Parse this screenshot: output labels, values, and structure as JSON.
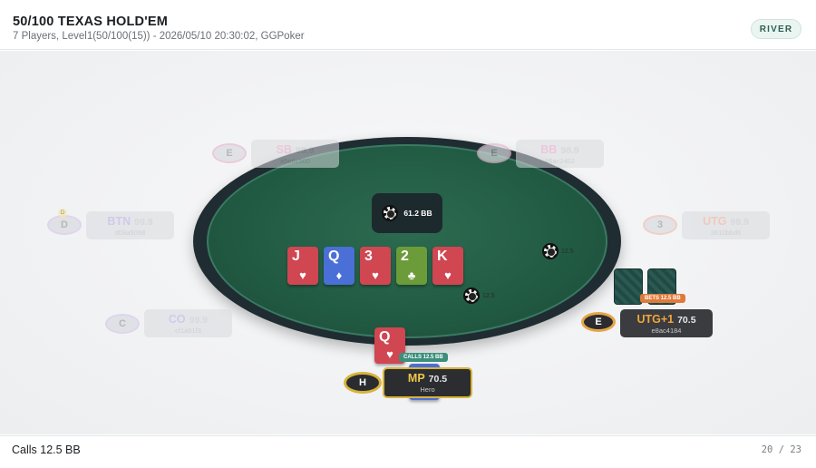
{
  "header": {
    "title": "50/100 TEXAS HOLD'EM",
    "subtitle": "7 Players, Level1(50/100(15)) - 2026/05/10 20:30:02, GGPoker",
    "street": "RIVER"
  },
  "pot": {
    "label": "61.2 BB"
  },
  "board": [
    {
      "rank": "J",
      "suit": "♥",
      "color": "red"
    },
    {
      "rank": "Q",
      "suit": "♦",
      "color": "blue"
    },
    {
      "rank": "3",
      "suit": "♥",
      "color": "red"
    },
    {
      "rank": "2",
      "suit": "♣",
      "color": "green"
    },
    {
      "rank": "K",
      "suit": "♥",
      "color": "red"
    }
  ],
  "bets": {
    "right": "12.5",
    "center": "12.5"
  },
  "seats": {
    "sb": {
      "avatar": "E",
      "position": "SB",
      "stack": "99.9",
      "id": "a5e6c500"
    },
    "bb": {
      "avatar": "E",
      "position": "BB",
      "stack": "98.9",
      "id": "86ac2402"
    },
    "btn": {
      "avatar": "D",
      "dealer": "D",
      "position": "BTN",
      "stack": "99.9",
      "id": "d09a5068"
    },
    "utg": {
      "avatar": "3",
      "position": "UTG",
      "stack": "99.9",
      "id": "3610bbd6"
    },
    "co": {
      "avatar": "C",
      "position": "CO",
      "stack": "99.9",
      "id": "cf1a61f3"
    },
    "utg1": {
      "avatar": "E",
      "position": "UTG+1",
      "stack": "70.5",
      "id": "e8ac4184",
      "action": "BETS 12.5 BB"
    },
    "mp": {
      "avatar": "H",
      "position": "MP",
      "stack": "70.5",
      "id": "Hero",
      "action": "CALLS 12.5 BB",
      "cards": [
        {
          "rank": "Q",
          "suit": "♥",
          "color": "red"
        },
        {
          "rank": "K",
          "suit": "♠",
          "color": "blue"
        }
      ]
    }
  },
  "footer": {
    "action_text": "Calls 12.5 BB",
    "step": "20 / 23"
  },
  "colors": {
    "felt": "#215a43",
    "rail": "#1f2d33",
    "hero_border": "#d7b33a",
    "bet_badge": "#e07a3a",
    "call_badge": "#3c8f7b"
  }
}
